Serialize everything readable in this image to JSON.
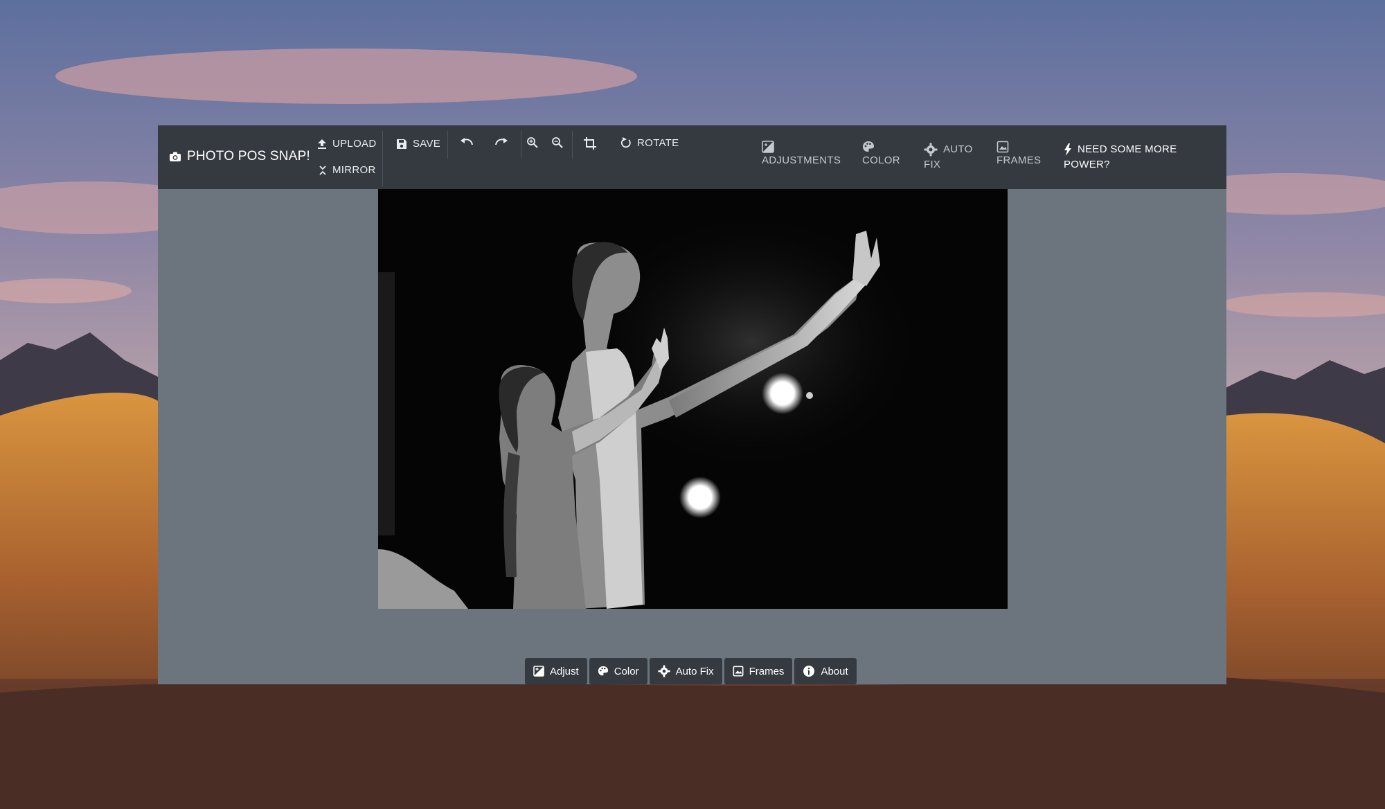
{
  "app": {
    "brand": "PHOTO POS SNAP!"
  },
  "toolbar": {
    "upload": "UPLOAD",
    "mirror": "MIRROR",
    "save": "SAVE",
    "rotate": "ROTATE"
  },
  "nav": {
    "adjustments": "ADJUSTMENTS",
    "color": "COLOR",
    "auto_fix_line1": "AUTO",
    "auto_fix_line2": "FIX",
    "frames": "FRAMES",
    "power_line1": "NEED SOME MORE",
    "power_line2": "POWER?"
  },
  "bottom_tabs": {
    "adjust": "Adjust",
    "color": "Color",
    "auto_fix": "Auto Fix",
    "frames": "Frames",
    "about": "About"
  },
  "icons": {
    "brand": "camera-icon",
    "upload": "upload-icon",
    "mirror": "mirror-icon",
    "save": "floppy-disk-icon",
    "undo": "undo-icon",
    "redo": "redo-icon",
    "zoom_in": "zoom-in-icon",
    "zoom_out": "zoom-out-icon",
    "crop": "crop-icon",
    "rotate": "rotate-icon",
    "adjustments": "adjustments-icon",
    "color": "palette-icon",
    "auto_fix": "gear-icon",
    "frames": "image-icon",
    "power": "bolt-icon",
    "about": "info-icon"
  },
  "colors": {
    "topbar": "#343a40",
    "workspace": "#6c757d",
    "text_light": "#e9ecef"
  }
}
